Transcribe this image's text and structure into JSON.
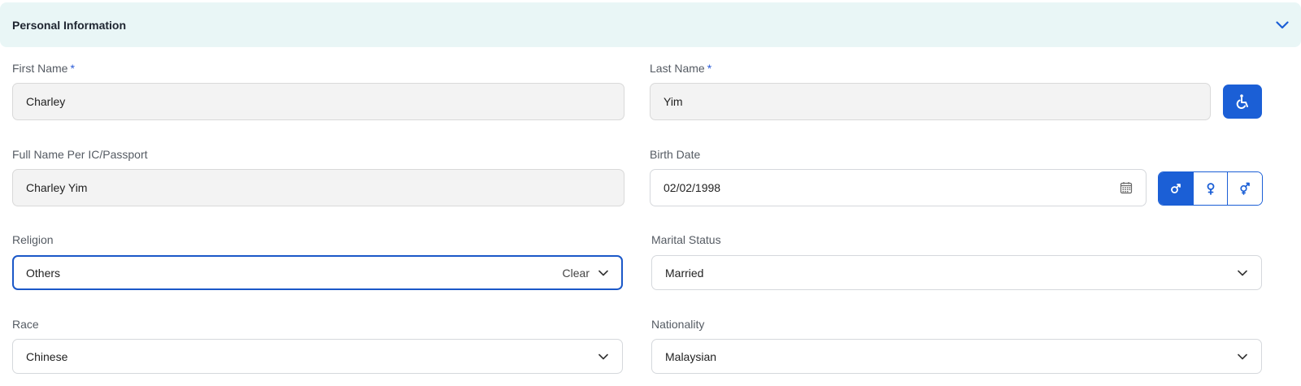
{
  "section": {
    "title": "Personal Information",
    "icon": "chevron-down-icon"
  },
  "required_marker": "*",
  "fields": {
    "first_name": {
      "label": "First Name",
      "value": "Charley",
      "required": true
    },
    "last_name": {
      "label": "Last Name",
      "value": "Yim",
      "required": true
    },
    "full_name": {
      "label": "Full Name Per IC/Passport",
      "value": "Charley Yim"
    },
    "birth_date": {
      "label": "Birth Date",
      "value": "02/02/1998",
      "icon": "calendar-icon"
    },
    "religion": {
      "label": "Religion",
      "value": "Others",
      "clear_label": "Clear"
    },
    "marital_status": {
      "label": "Marital Status",
      "value": "Married"
    },
    "race": {
      "label": "Race",
      "value": "Chinese"
    },
    "nationality": {
      "label": "Nationality",
      "value": "Malaysian"
    }
  },
  "disability_button": {
    "icon": "wheelchair-icon"
  },
  "gender": {
    "options": [
      {
        "icon": "male-icon",
        "selected": true
      },
      {
        "icon": "female-icon",
        "selected": false
      },
      {
        "icon": "other-gender-icon",
        "selected": false
      }
    ]
  },
  "colors": {
    "accent": "#1b5fd6",
    "header_bg": "#e9f6f6",
    "required": "#2a5bd7"
  }
}
